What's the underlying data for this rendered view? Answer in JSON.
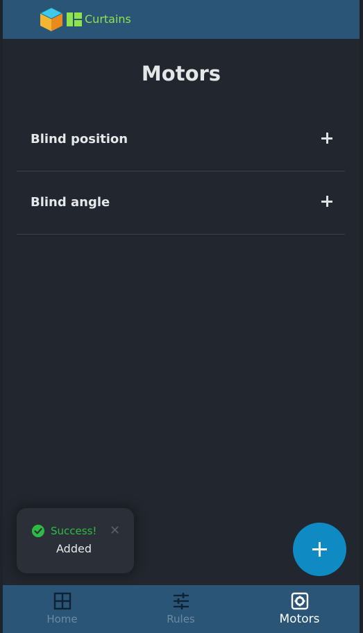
{
  "header": {
    "app_name": "Curtains"
  },
  "page": {
    "title": "Motors"
  },
  "motors": [
    {
      "label": "Blind position"
    },
    {
      "label": "Blind angle"
    }
  ],
  "toast": {
    "title": "Success!",
    "message": "Added",
    "close_glyph": "✕"
  },
  "fab": {
    "icon": "plus-icon"
  },
  "bottom_nav": {
    "items": [
      {
        "label": "Home",
        "icon": "grid-icon",
        "active": false
      },
      {
        "label": "Rules",
        "icon": "sliders-icon",
        "active": false
      },
      {
        "label": "Motors",
        "icon": "gear-icon",
        "active": true
      }
    ]
  },
  "colors": {
    "header_bg": "#2b5577",
    "page_bg": "#22272f",
    "accent_green": "#8fe34c",
    "success_green": "#2fba46",
    "fab_blue": "#0f8ac2"
  }
}
